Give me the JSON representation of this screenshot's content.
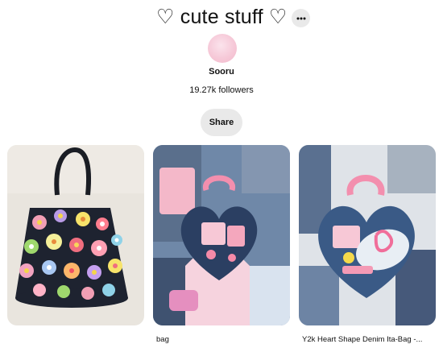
{
  "board": {
    "title": "♡ cute stuff ♡",
    "owner_name": "Sooru",
    "followers": "19.27k followers",
    "share_label": "Share",
    "more_icon": "ellipsis-icon"
  },
  "pins": [
    {
      "caption": "",
      "image": "crochet-flower-tote-bag"
    },
    {
      "caption": "bag",
      "image": "pink-heart-denim-bag"
    },
    {
      "caption": "Y2k Heart Shape Denim Ita-Bag -...",
      "image": "heart-denim-ita-bag"
    }
  ],
  "colors": {
    "button_bg": "#e9e9e9",
    "avatar_pink": "#f6c9d8",
    "text": "#111111"
  }
}
